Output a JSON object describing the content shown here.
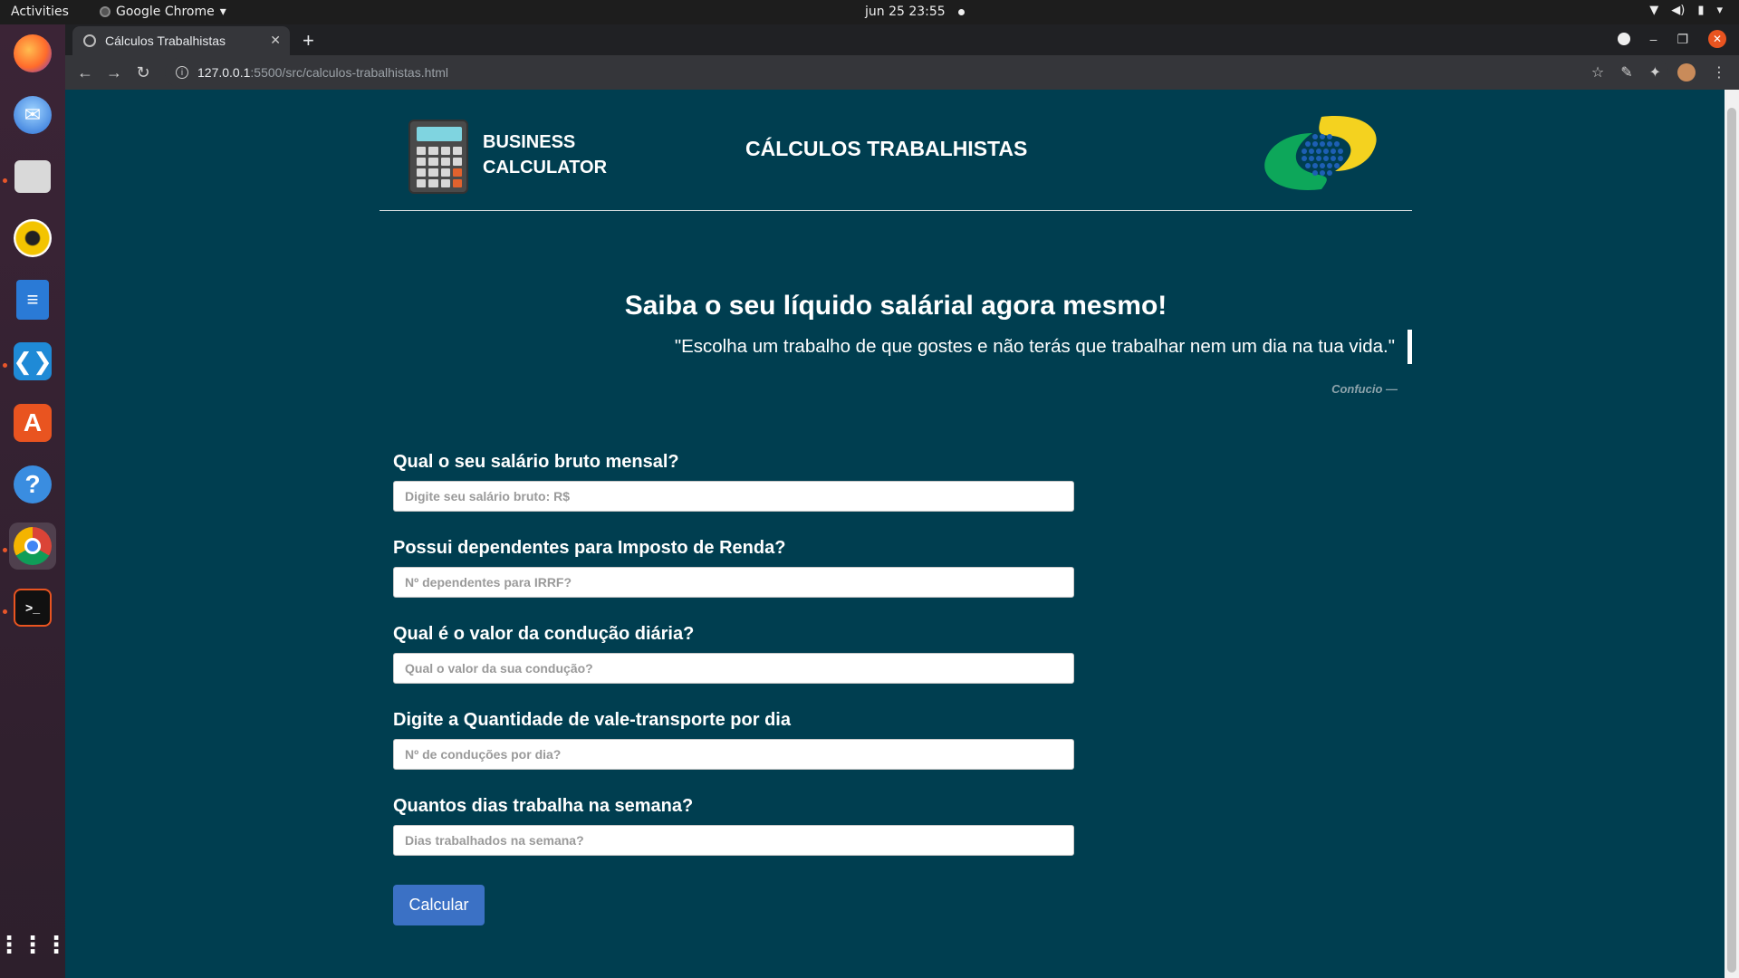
{
  "system_bar": {
    "activities": "Activities",
    "app_name": "Google Chrome",
    "datetime": "jun 25  23:55"
  },
  "browser": {
    "tab_title": "Cálculos Trabalhistas",
    "url_host": "127.0.0.1",
    "url_path": ":5500/src/calculos-trabalhistas.html"
  },
  "header": {
    "brand_line1": "BUSINESS",
    "brand_line2": "CALCULATOR",
    "title": "CÁLCULOS TRABALHISTAS"
  },
  "hero": {
    "heading": "Saiba o seu líquido salárial agora mesmo!",
    "quote": "\"Escolha um trabalho de que gostes e não terás que trabalhar nem um dia na tua vida.\"",
    "author": "Confucio —"
  },
  "form": {
    "fields": [
      {
        "label": "Qual o seu salário bruto mensal?",
        "placeholder": "Digite seu salário bruto: R$"
      },
      {
        "label": "Possui dependentes para Imposto de Renda?",
        "placeholder": "Nº dependentes para IRRF?"
      },
      {
        "label": "Qual é o valor da condução diária?",
        "placeholder": "Qual o valor da sua condução?"
      },
      {
        "label": "Digite a Quantidade de vale-transporte por dia",
        "placeholder": "Nº de conduções por dia?"
      },
      {
        "label": "Quantos dias trabalha na semana?",
        "placeholder": "Dias trabalhados na semana?"
      }
    ],
    "submit_label": "Calcular"
  },
  "colors": {
    "page_bg": "#003e50",
    "button_bg": "#3b71c5",
    "author_text": "#8da3ab"
  }
}
